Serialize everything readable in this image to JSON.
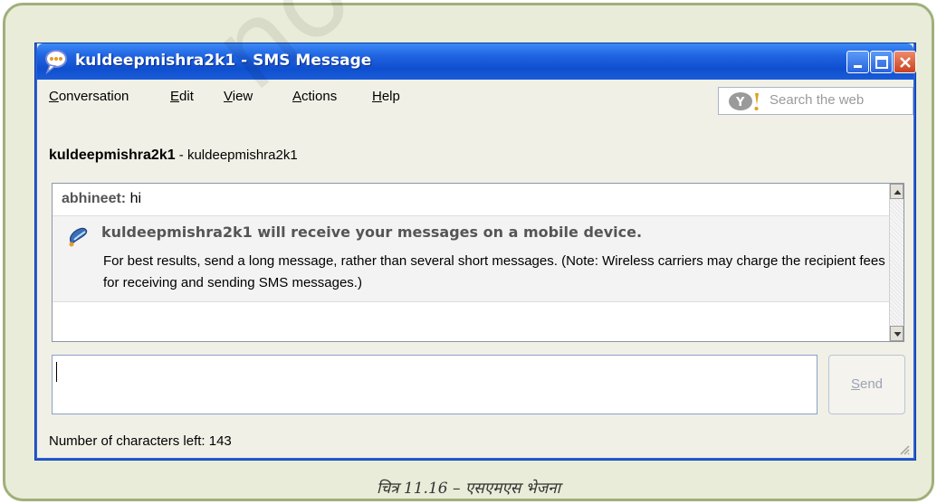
{
  "window": {
    "title": "kuldeepmishra2k1 - SMS Message"
  },
  "menu": {
    "items": [
      {
        "label": "Conversation",
        "accel": "C"
      },
      {
        "label": "Edit",
        "accel": "E"
      },
      {
        "label": "View",
        "accel": "V"
      },
      {
        "label": "Actions",
        "accel": "A"
      },
      {
        "label": "Help",
        "accel": "H"
      }
    ]
  },
  "search": {
    "placeholder": "Search the web"
  },
  "contact": {
    "name": "kuldeepmishra2k1",
    "separator": " - ",
    "id": "kuldeepmishra2k1"
  },
  "history": {
    "sender": "abhineet:",
    "message": "hi",
    "notice_title": "kuldeepmishra2k1 will receive your messages on a mobile device.",
    "notice_body": "For best results, send a long message, rather than several short messages. (Note: Wireless carriers may charge the recipient fees for receiving and sending SMS messages.)"
  },
  "compose": {
    "send_label": "Send"
  },
  "status": {
    "text": "Number of characters left: 143"
  },
  "caption": "चित्र 11.16 – एसएमएस भेजना",
  "watermark": "not to be",
  "colors": {
    "titlebar": "#1f63e0",
    "frame_border": "#9fb07a",
    "frame_fill": "#e8ecd8"
  }
}
